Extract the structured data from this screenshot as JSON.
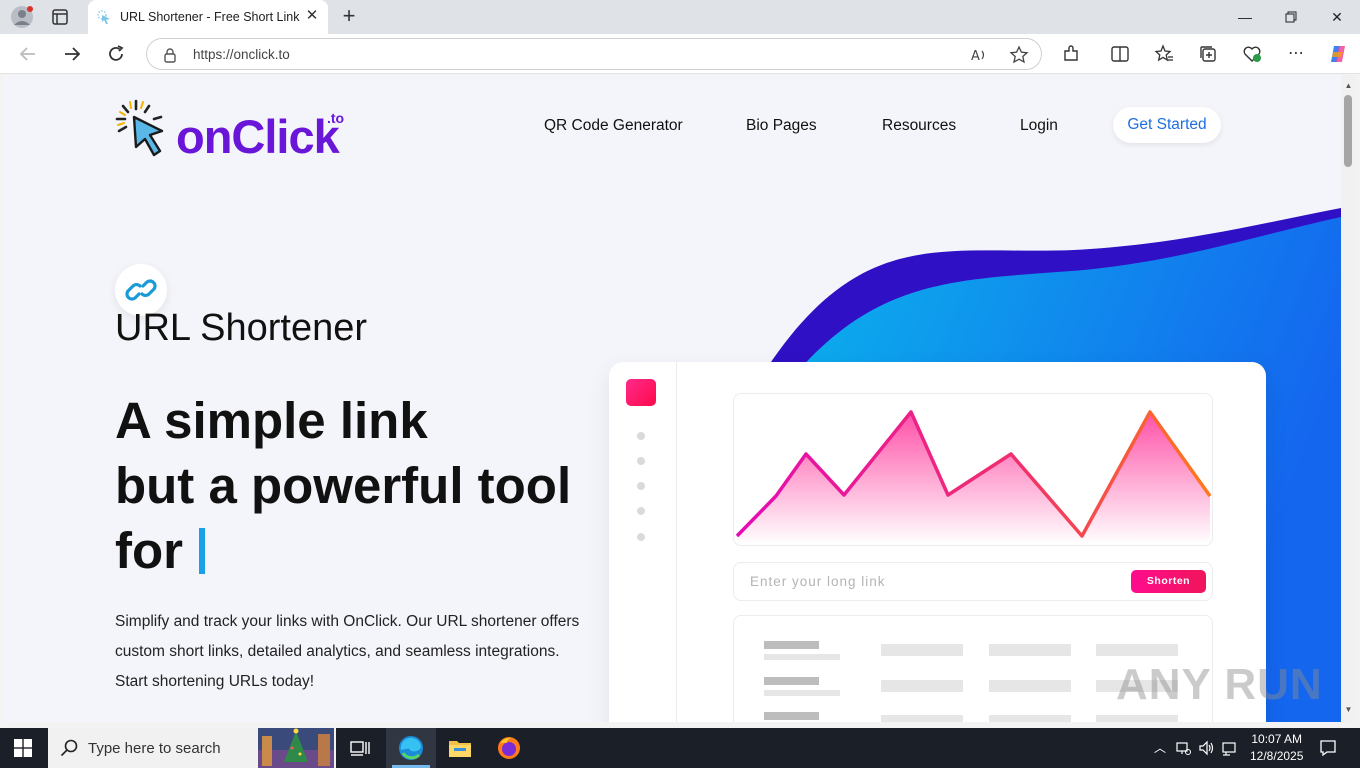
{
  "browser": {
    "tab_title": "URL Shortener - Free Short Link &",
    "url": "https://onclick.to",
    "window_controls": [
      "minimize-icon",
      "restore-icon",
      "close-icon"
    ]
  },
  "site": {
    "logo_word": "onClick",
    "logo_tld": ".to",
    "nav": [
      "QR Code Generator",
      "Bio Pages",
      "Resources",
      "Login"
    ],
    "cta": "Get Started",
    "kicker": "URL Shortener",
    "headline": [
      "A simple link",
      "but a powerful tool",
      "for"
    ],
    "description": "Simplify and track your links with OnClick. Our URL shortener offers custom short links, detailed analytics, and seamless integrations. Start shortening URLs today!",
    "mockup": {
      "input_placeholder": "Enter your long link",
      "button": "Shorten"
    },
    "colors": {
      "brand": "#6a16d8",
      "cta_text": "#1f6fe0",
      "wave_dark": "#3310c8",
      "wave_light": "#1a9ef0",
      "accent_pink": "#ff0c8e"
    }
  },
  "watermark": "ANY RUN",
  "taskbar": {
    "search_placeholder": "Type here to search",
    "time": "10:07 AM",
    "date": "12/8/2025"
  }
}
